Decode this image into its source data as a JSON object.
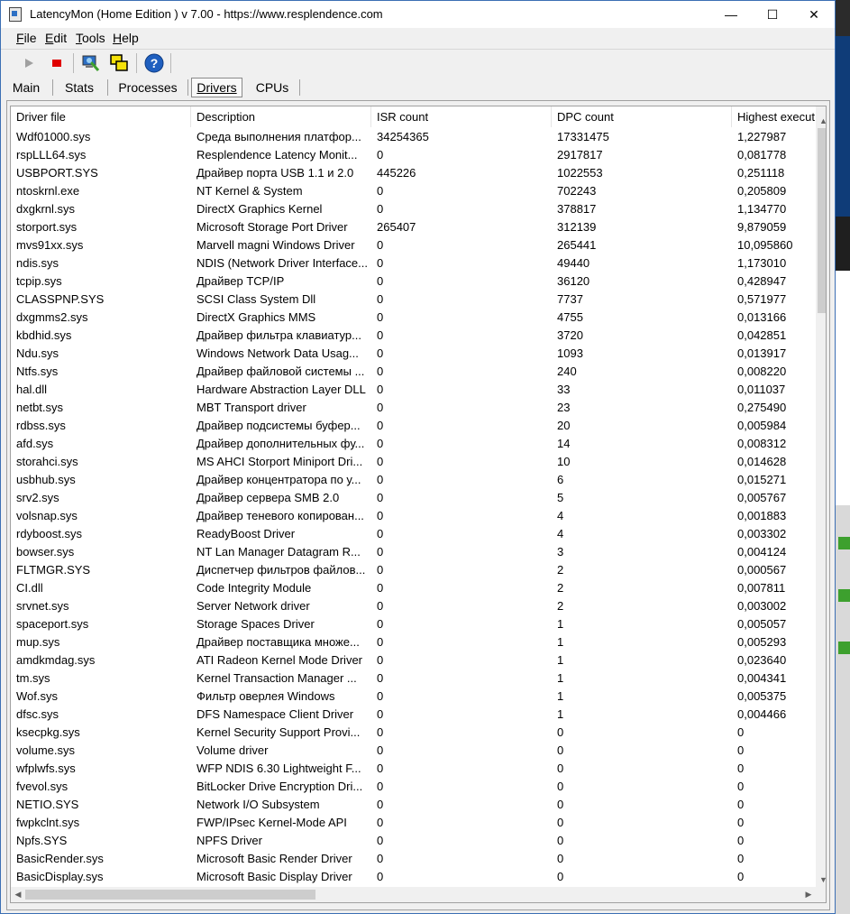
{
  "window": {
    "title": "LatencyMon  (Home Edition )  v 7.00 - https://www.resplendence.com",
    "controls": {
      "minimize": "—",
      "maximize": "☐",
      "close": "✕"
    }
  },
  "menu": [
    "File",
    "Edit",
    "Tools",
    "Help"
  ],
  "toolbar": {
    "icons": [
      "play-icon",
      "stop-icon",
      "monitor-icon",
      "windows-icon",
      "help-icon"
    ]
  },
  "tabs": [
    "Main",
    "Stats",
    "Processes",
    "Drivers",
    "CPUs"
  ],
  "active_tab": "Drivers",
  "table": {
    "columns": [
      "Driver file",
      "Description",
      "ISR count",
      "DPC count",
      "Highest execut"
    ],
    "rows": [
      [
        "Wdf01000.sys",
        "Среда выполнения платфор...",
        "34254365",
        "17331475",
        "1,227987"
      ],
      [
        "rspLLL64.sys",
        "Resplendence Latency Monit...",
        "0",
        "2917817",
        "0,081778"
      ],
      [
        "USBPORT.SYS",
        "Драйвер порта USB 1.1 и 2.0",
        "445226",
        "1022553",
        "0,251118"
      ],
      [
        "ntoskrnl.exe",
        "NT Kernel & System",
        "0",
        "702243",
        "0,205809"
      ],
      [
        "dxgkrnl.sys",
        "DirectX Graphics Kernel",
        "0",
        "378817",
        "1,134770"
      ],
      [
        "storport.sys",
        "Microsoft Storage Port Driver",
        "265407",
        "312139",
        "9,879059"
      ],
      [
        "mvs91xx.sys",
        "Marvell magni Windows Driver",
        "0",
        "265441",
        "10,095860"
      ],
      [
        "ndis.sys",
        "NDIS (Network Driver Interface...",
        "0",
        "49440",
        "1,173010"
      ],
      [
        "tcpip.sys",
        "Драйвер TCP/IP",
        "0",
        "36120",
        "0,428947"
      ],
      [
        "CLASSPNP.SYS",
        "SCSI Class System Dll",
        "0",
        "7737",
        "0,571977"
      ],
      [
        "dxgmms2.sys",
        "DirectX Graphics MMS",
        "0",
        "4755",
        "0,013166"
      ],
      [
        "kbdhid.sys",
        "Драйвер фильтра клавиатур...",
        "0",
        "3720",
        "0,042851"
      ],
      [
        "Ndu.sys",
        "Windows Network Data Usag...",
        "0",
        "1093",
        "0,013917"
      ],
      [
        "Ntfs.sys",
        "Драйвер файловой системы ...",
        "0",
        "240",
        "0,008220"
      ],
      [
        "hal.dll",
        "Hardware Abstraction Layer DLL",
        "0",
        "33",
        "0,011037"
      ],
      [
        "netbt.sys",
        "MBT Transport driver",
        "0",
        "23",
        "0,275490"
      ],
      [
        "rdbss.sys",
        "Драйвер подсистемы буфер...",
        "0",
        "20",
        "0,005984"
      ],
      [
        "afd.sys",
        "Драйвер дополнительных фу...",
        "0",
        "14",
        "0,008312"
      ],
      [
        "storahci.sys",
        "MS AHCI Storport Miniport Dri...",
        "0",
        "10",
        "0,014628"
      ],
      [
        "usbhub.sys",
        "Драйвер концентратора по у...",
        "0",
        "6",
        "0,015271"
      ],
      [
        "srv2.sys",
        "Драйвер сервера SMB 2.0",
        "0",
        "5",
        "0,005767"
      ],
      [
        "volsnap.sys",
        "Драйвер теневого копирован...",
        "0",
        "4",
        "0,001883"
      ],
      [
        "rdyboost.sys",
        "ReadyBoost Driver",
        "0",
        "4",
        "0,003302"
      ],
      [
        "bowser.sys",
        "NT Lan Manager Datagram R...",
        "0",
        "3",
        "0,004124"
      ],
      [
        "FLTMGR.SYS",
        "Диспетчер фильтров файлов...",
        "0",
        "2",
        "0,000567"
      ],
      [
        "CI.dll",
        "Code Integrity Module",
        "0",
        "2",
        "0,007811"
      ],
      [
        "srvnet.sys",
        "Server Network driver",
        "0",
        "2",
        "0,003002"
      ],
      [
        "spaceport.sys",
        "Storage Spaces Driver",
        "0",
        "1",
        "0,005057"
      ],
      [
        "mup.sys",
        "Драйвер поставщика множе...",
        "0",
        "1",
        "0,005293"
      ],
      [
        "amdkmdag.sys",
        "ATI Radeon Kernel Mode Driver",
        "0",
        "1",
        "0,023640"
      ],
      [
        "tm.sys",
        "Kernel Transaction Manager ...",
        "0",
        "1",
        "0,004341"
      ],
      [
        "Wof.sys",
        "Фильтр оверлея Windows",
        "0",
        "1",
        "0,005375"
      ],
      [
        "dfsc.sys",
        "DFS Namespace Client Driver",
        "0",
        "1",
        "0,004466"
      ],
      [
        "ksecpkg.sys",
        "Kernel Security Support Provi...",
        "0",
        "0",
        "0"
      ],
      [
        "volume.sys",
        "Volume driver",
        "0",
        "0",
        "0"
      ],
      [
        "wfplwfs.sys",
        "WFP NDIS 6.30 Lightweight F...",
        "0",
        "0",
        "0"
      ],
      [
        "fvevol.sys",
        "BitLocker Drive Encryption Dri...",
        "0",
        "0",
        "0"
      ],
      [
        "NETIO.SYS",
        "Network I/O Subsystem",
        "0",
        "0",
        "0"
      ],
      [
        "fwpkclnt.sys",
        "FWP/IPsec Kernel-Mode API",
        "0",
        "0",
        "0"
      ],
      [
        "Npfs.SYS",
        "NPFS Driver",
        "0",
        "0",
        "0"
      ],
      [
        "BasicRender.sys",
        "Microsoft Basic Render Driver",
        "0",
        "0",
        "0"
      ],
      [
        "BasicDisplay.sys",
        "Microsoft Basic Display Driver",
        "0",
        "0",
        "0"
      ]
    ]
  },
  "colors": {
    "accent": "#3c6fb4",
    "stop": "#e00000",
    "play": "#a0a0a0"
  }
}
